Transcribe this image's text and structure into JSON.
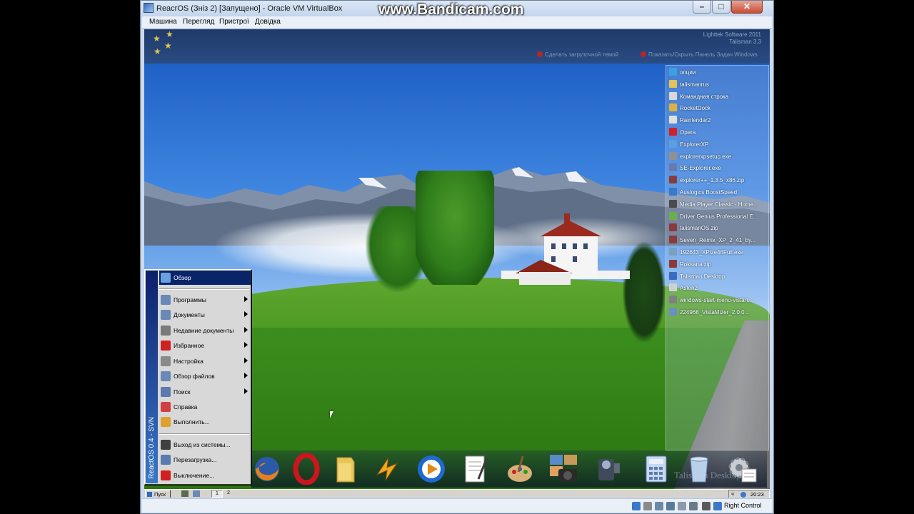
{
  "watermark": "www.Bandicam.com",
  "window": {
    "title": "ReacrOS (Знiз 2) [Запущено] - Oracle VM VirtualBox",
    "menu": [
      "Машина",
      "Перегляд",
      "Пристрої",
      "Довідка"
    ]
  },
  "talisman": {
    "company": "Lighttek Software 2011",
    "version": "Talisman 3.3",
    "link_boot_theme": "Сделать загрузочной темой",
    "link_toggle_taskbar": "Показать/Скрыть Панель Задач Windows",
    "dock_label": "Talisman Desktop"
  },
  "right_panel": {
    "items": [
      {
        "label": "опции",
        "icon": "play-icon",
        "color": "#3da0e0"
      },
      {
        "label": "talismanrus",
        "icon": "folder-icon",
        "color": "#e3c45a"
      },
      {
        "label": "Командная строка",
        "icon": "cmd-icon",
        "color": "#d8d8d8"
      },
      {
        "label": "RocketDock",
        "icon": "rocketdock-icon",
        "color": "#e0b040"
      },
      {
        "label": "Rainlendar2",
        "icon": "calendar-icon",
        "color": "#e0e0e0"
      },
      {
        "label": "Opera",
        "icon": "opera-icon",
        "color": "#d0202a"
      },
      {
        "label": "ExplorerXP",
        "icon": "explorerxp-icon",
        "color": "#5aa0e0"
      },
      {
        "label": "explorerxpsetup.exe",
        "icon": "setup-icon",
        "color": "#909090"
      },
      {
        "label": "SE-Explorer.exe",
        "icon": "app-icon",
        "color": "#6a7ab0"
      },
      {
        "label": "explorer++_1.3.5_x86.zip",
        "icon": "archive-icon",
        "color": "#8a3a3a"
      },
      {
        "label": "Auslogics BoostSpeed",
        "icon": "boostspeed-icon",
        "color": "#3a78c8"
      },
      {
        "label": "Media Player Classic - Home...",
        "icon": "mpc-icon",
        "color": "#4a4a4a"
      },
      {
        "label": "Driver Genius Professional E...",
        "icon": "driver-icon",
        "color": "#6ab04a"
      },
      {
        "label": "talismanOS.zip",
        "icon": "archive-icon",
        "color": "#8a3a3a"
      },
      {
        "label": "Seven_Remix_XP_2_41_by...",
        "icon": "archive-icon",
        "color": "#8a3a3a"
      },
      {
        "label": "192643_XPize46Full.exe",
        "icon": "setup-icon",
        "color": "#7aa0c0"
      },
      {
        "label": "Roksana.zip",
        "icon": "archive-icon",
        "color": "#8a3a3a"
      },
      {
        "label": "Talisman Desktop",
        "icon": "talisman-icon",
        "color": "#3a6ac0"
      },
      {
        "label": "Aston2",
        "icon": "aston-icon",
        "color": "#d0d0d0"
      },
      {
        "label": "windows-start-menu-vistart...",
        "icon": "app-icon",
        "color": "#808080"
      },
      {
        "label": "224968_VistaMizer_2.0.0...",
        "icon": "setup-icon",
        "color": "#6a90c0"
      }
    ]
  },
  "start_menu": {
    "side_text": "ReactOS 0.4 - SVN",
    "items": [
      {
        "label": "Обзор",
        "icon": "browse-icon",
        "arrow": false,
        "selected": true,
        "color": "#6aa0e0"
      },
      {
        "label": "Программы",
        "icon": "programs-icon",
        "arrow": true,
        "selected": false,
        "color": "#6a88b8"
      },
      {
        "label": "Документы",
        "icon": "documents-icon",
        "arrow": true,
        "selected": false,
        "color": "#6a88b8"
      },
      {
        "label": "Недавние документы",
        "icon": "recent-documents-icon",
        "arrow": true,
        "selected": false,
        "color": "#7a7a7a"
      },
      {
        "label": "Избранное",
        "icon": "favorites-icon",
        "arrow": true,
        "selected": false,
        "color": "#d02020"
      },
      {
        "label": "Настройка",
        "icon": "settings-icon",
        "arrow": true,
        "selected": false,
        "color": "#8a8a8a"
      },
      {
        "label": "Обзор файлов",
        "icon": "file-browser-icon",
        "arrow": true,
        "selected": false,
        "color": "#6a88b8"
      },
      {
        "label": "Поиск",
        "icon": "search-icon",
        "arrow": true,
        "selected": false,
        "color": "#5a7ab0"
      },
      {
        "label": "Справка",
        "icon": "help-icon",
        "arrow": false,
        "selected": false,
        "color": "#d04040"
      },
      {
        "label": "Выполнить...",
        "icon": "run-icon",
        "arrow": false,
        "selected": false,
        "color": "#e0a030"
      }
    ],
    "footer_items": [
      {
        "label": "Выход из системы...",
        "icon": "logoff-icon",
        "color": "#404040"
      },
      {
        "label": "Перезагрузка...",
        "icon": "restart-icon",
        "color": "#5a7ab0"
      },
      {
        "label": "Выключение...",
        "icon": "shutdown-icon",
        "color": "#d02020"
      }
    ]
  },
  "taskbar": {
    "start_label": "Пуск",
    "pages": [
      "1",
      "2"
    ],
    "tray_chevron": "«",
    "clock": "20:23"
  },
  "status_bar": {
    "host_key": "Right Control"
  }
}
